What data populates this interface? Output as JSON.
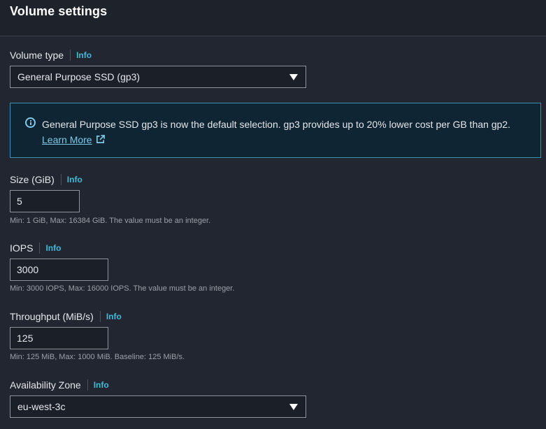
{
  "header": {
    "title": "Volume settings"
  },
  "volume_type": {
    "label": "Volume type",
    "info": "Info",
    "value": "General Purpose SSD (gp3)"
  },
  "alert": {
    "message": "General Purpose SSD gp3 is now the default selection. gp3 provides up to 20% lower cost per GB than gp2.",
    "link": "Learn More"
  },
  "size": {
    "label": "Size (GiB)",
    "info": "Info",
    "value": "5",
    "hint": "Min: 1 GiB, Max: 16384 GiB. The value must be an integer."
  },
  "iops": {
    "label": "IOPS",
    "info": "Info",
    "value": "3000",
    "hint": "Min: 3000 IOPS, Max: 16000 IOPS. The value must be an integer."
  },
  "throughput": {
    "label": "Throughput (MiB/s)",
    "info": "Info",
    "value": "125",
    "hint": "Min: 125 MiB, Max: 1000 MiB. Baseline: 125 MiB/s."
  },
  "availability_zone": {
    "label": "Availability Zone",
    "info": "Info",
    "value": "eu-west-3c"
  },
  "icons": {
    "info_circle": "info-circle-icon",
    "external_link": "external-link-icon",
    "dropdown": "caret-down-icon"
  },
  "colors": {
    "background": "#222630",
    "info_link": "#44b9d6",
    "alert_border": "#3b8fb0",
    "alert_bg": "#0f2533"
  }
}
